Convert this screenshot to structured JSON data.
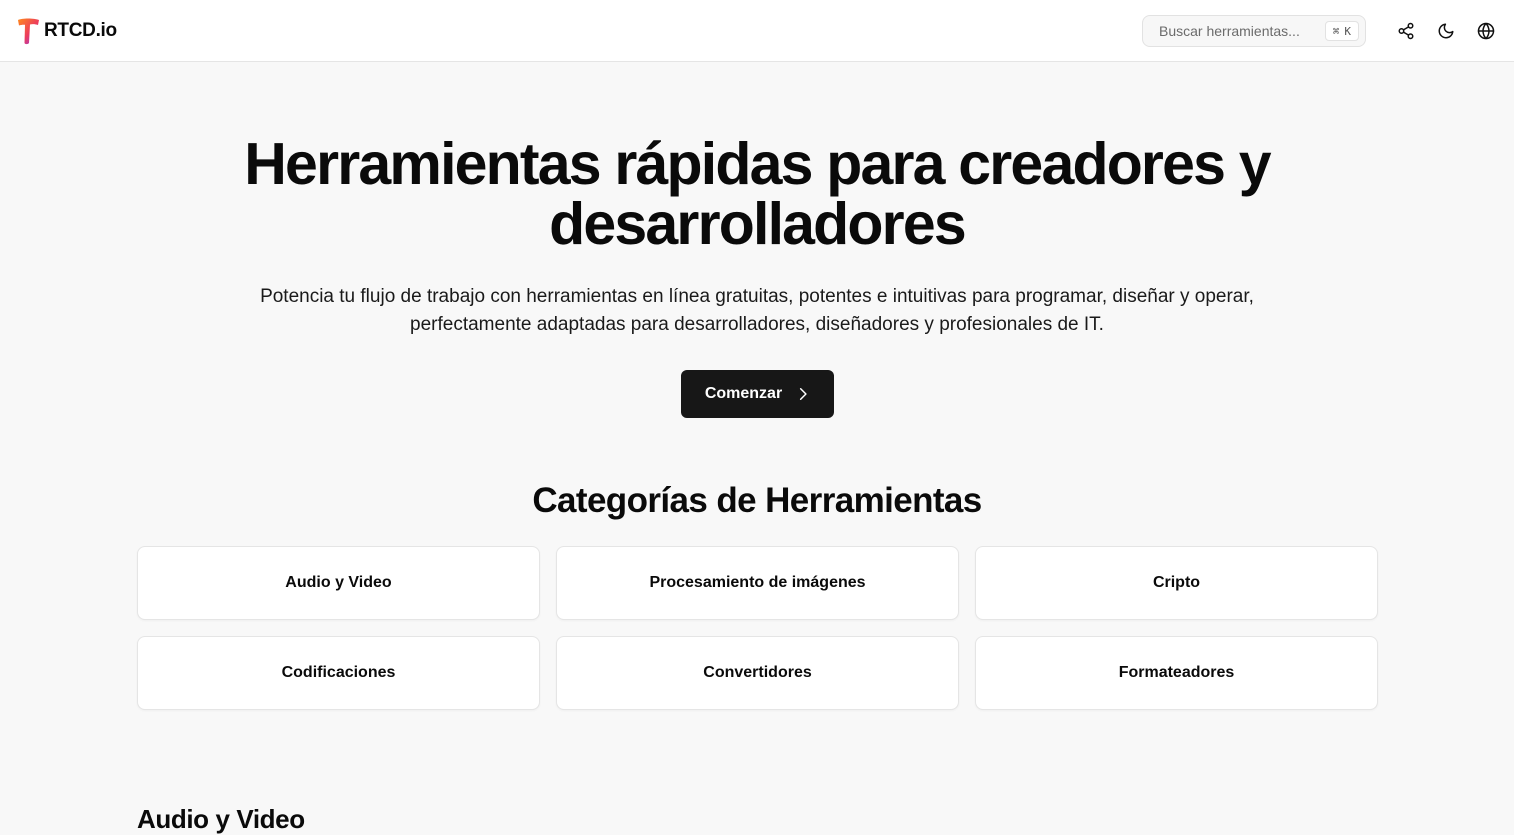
{
  "header": {
    "brand_name": "RTCD.io",
    "search": {
      "placeholder": "Buscar herramientas...",
      "shortcut_symbol": "⌘",
      "shortcut_key": "K"
    },
    "icons": [
      "share-icon",
      "moon-icon",
      "globe-icon"
    ]
  },
  "hero": {
    "title_line1": "Herramientas rápidas para creadores y",
    "title_line2": "desarrolladores",
    "subtitle_line1": "Potencia tu flujo de trabajo con herramientas en línea gratuitas, potentes e intuitivas para programar, diseñar y operar,",
    "subtitle_line2": "perfectamente adaptadas para desarrolladores, diseñadores y profesionales de IT.",
    "cta_label": "Comenzar"
  },
  "categories": {
    "title": "Categorías de Herramientas",
    "items": [
      {
        "label": "Audio y Video"
      },
      {
        "label": "Procesamiento de imágenes"
      },
      {
        "label": "Cripto"
      },
      {
        "label": "Codificaciones"
      },
      {
        "label": "Convertidores"
      },
      {
        "label": "Formateadores"
      }
    ]
  },
  "next_section": {
    "title": "Audio y Video"
  },
  "colors": {
    "page_background": "#f8f8f8",
    "card_background": "#ffffff",
    "button_background": "#171717",
    "text": "#0a0a0a",
    "logo_gradient": [
      "#ff7a18",
      "#e8345a",
      "#8b3cf7"
    ]
  }
}
